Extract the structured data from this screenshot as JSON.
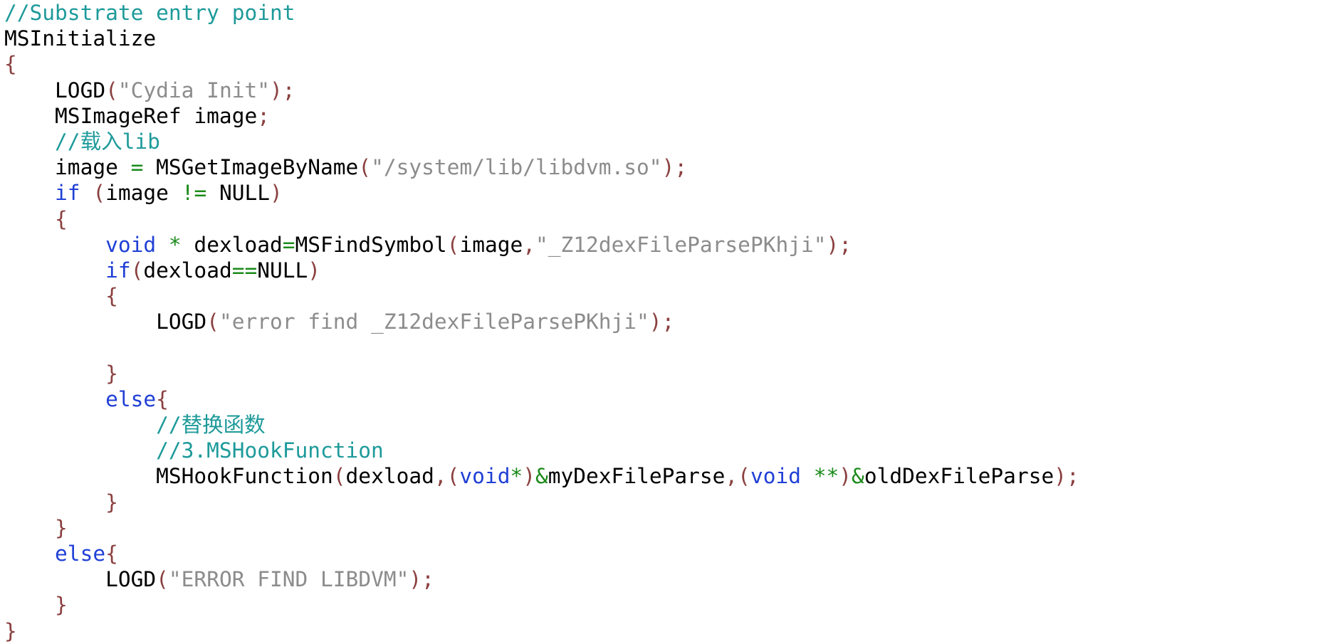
{
  "colors": {
    "comment": "#1e9a9a",
    "plain": "#000000",
    "punct": "#8b4040",
    "string": "#8c8c8c",
    "keyword": "#1f3fd6",
    "operator": "#1a8a1a"
  },
  "code": {
    "lines": [
      {
        "tokens": [
          {
            "t": "//Substrate entry point",
            "c": "comment"
          }
        ]
      },
      {
        "tokens": [
          {
            "t": "MSInitialize",
            "c": "plain"
          }
        ]
      },
      {
        "tokens": [
          {
            "t": "{",
            "c": "punct"
          }
        ]
      },
      {
        "tokens": [
          {
            "t": "    LOGD",
            "c": "plain"
          },
          {
            "t": "(",
            "c": "punct"
          },
          {
            "t": "\"Cydia Init\"",
            "c": "string"
          },
          {
            "t": ");",
            "c": "punct"
          }
        ]
      },
      {
        "tokens": [
          {
            "t": "    MSImageRef image",
            "c": "plain"
          },
          {
            "t": ";",
            "c": "punct"
          }
        ]
      },
      {
        "tokens": [
          {
            "t": "    //载入lib",
            "c": "comment"
          }
        ]
      },
      {
        "tokens": [
          {
            "t": "    image ",
            "c": "plain"
          },
          {
            "t": "=",
            "c": "operator"
          },
          {
            "t": " MSGetImageByName",
            "c": "plain"
          },
          {
            "t": "(",
            "c": "punct"
          },
          {
            "t": "\"/system/lib/libdvm.so\"",
            "c": "string"
          },
          {
            "t": ");",
            "c": "punct"
          }
        ]
      },
      {
        "tokens": [
          {
            "t": "    ",
            "c": "plain"
          },
          {
            "t": "if",
            "c": "keyword"
          },
          {
            "t": " (",
            "c": "punct"
          },
          {
            "t": "image ",
            "c": "plain"
          },
          {
            "t": "!=",
            "c": "operator"
          },
          {
            "t": " NULL",
            "c": "plain"
          },
          {
            "t": ")",
            "c": "punct"
          }
        ]
      },
      {
        "tokens": [
          {
            "t": "    {",
            "c": "punct"
          }
        ]
      },
      {
        "tokens": [
          {
            "t": "        ",
            "c": "plain"
          },
          {
            "t": "void",
            "c": "keyword"
          },
          {
            "t": " *",
            "c": "operator"
          },
          {
            "t": " dexload",
            "c": "plain"
          },
          {
            "t": "=",
            "c": "operator"
          },
          {
            "t": "MSFindSymbol",
            "c": "plain"
          },
          {
            "t": "(",
            "c": "punct"
          },
          {
            "t": "image",
            "c": "plain"
          },
          {
            "t": ",",
            "c": "punct"
          },
          {
            "t": "\"_Z12dexFileParsePKhji\"",
            "c": "string"
          },
          {
            "t": ");",
            "c": "punct"
          }
        ]
      },
      {
        "tokens": [
          {
            "t": "        ",
            "c": "plain"
          },
          {
            "t": "if",
            "c": "keyword"
          },
          {
            "t": "(",
            "c": "punct"
          },
          {
            "t": "dexload",
            "c": "plain"
          },
          {
            "t": "==",
            "c": "operator"
          },
          {
            "t": "NULL",
            "c": "plain"
          },
          {
            "t": ")",
            "c": "punct"
          }
        ]
      },
      {
        "tokens": [
          {
            "t": "        {",
            "c": "punct"
          }
        ]
      },
      {
        "tokens": [
          {
            "t": "            LOGD",
            "c": "plain"
          },
          {
            "t": "(",
            "c": "punct"
          },
          {
            "t": "\"error find _Z12dexFileParsePKhji\"",
            "c": "string"
          },
          {
            "t": ");",
            "c": "punct"
          }
        ]
      },
      {
        "tokens": [
          {
            "t": "",
            "c": "plain"
          }
        ]
      },
      {
        "tokens": [
          {
            "t": "        }",
            "c": "punct"
          }
        ]
      },
      {
        "tokens": [
          {
            "t": "        ",
            "c": "plain"
          },
          {
            "t": "else",
            "c": "keyword"
          },
          {
            "t": "{",
            "c": "punct"
          }
        ]
      },
      {
        "tokens": [
          {
            "t": "            //替换函数",
            "c": "comment"
          }
        ]
      },
      {
        "tokens": [
          {
            "t": "            //3.MSHookFunction",
            "c": "comment"
          }
        ]
      },
      {
        "tokens": [
          {
            "t": "            MSHookFunction",
            "c": "plain"
          },
          {
            "t": "(",
            "c": "punct"
          },
          {
            "t": "dexload",
            "c": "plain"
          },
          {
            "t": ",(",
            "c": "punct"
          },
          {
            "t": "void",
            "c": "keyword"
          },
          {
            "t": "*",
            "c": "operator"
          },
          {
            "t": ")",
            "c": "punct"
          },
          {
            "t": "&",
            "c": "operator"
          },
          {
            "t": "myDexFileParse",
            "c": "plain"
          },
          {
            "t": ",(",
            "c": "punct"
          },
          {
            "t": "void",
            "c": "keyword"
          },
          {
            "t": " **",
            "c": "operator"
          },
          {
            "t": ")",
            "c": "punct"
          },
          {
            "t": "&",
            "c": "operator"
          },
          {
            "t": "oldDexFileParse",
            "c": "plain"
          },
          {
            "t": ");",
            "c": "punct"
          }
        ]
      },
      {
        "tokens": [
          {
            "t": "        }",
            "c": "punct"
          }
        ]
      },
      {
        "tokens": [
          {
            "t": "    }",
            "c": "punct"
          }
        ]
      },
      {
        "tokens": [
          {
            "t": "    ",
            "c": "plain"
          },
          {
            "t": "else",
            "c": "keyword"
          },
          {
            "t": "{",
            "c": "punct"
          }
        ]
      },
      {
        "tokens": [
          {
            "t": "        LOGD",
            "c": "plain"
          },
          {
            "t": "(",
            "c": "punct"
          },
          {
            "t": "\"ERROR FIND LIBDVM\"",
            "c": "string"
          },
          {
            "t": ");",
            "c": "punct"
          }
        ]
      },
      {
        "tokens": [
          {
            "t": "    }",
            "c": "punct"
          }
        ]
      },
      {
        "tokens": [
          {
            "t": "}",
            "c": "punct"
          }
        ]
      }
    ]
  }
}
